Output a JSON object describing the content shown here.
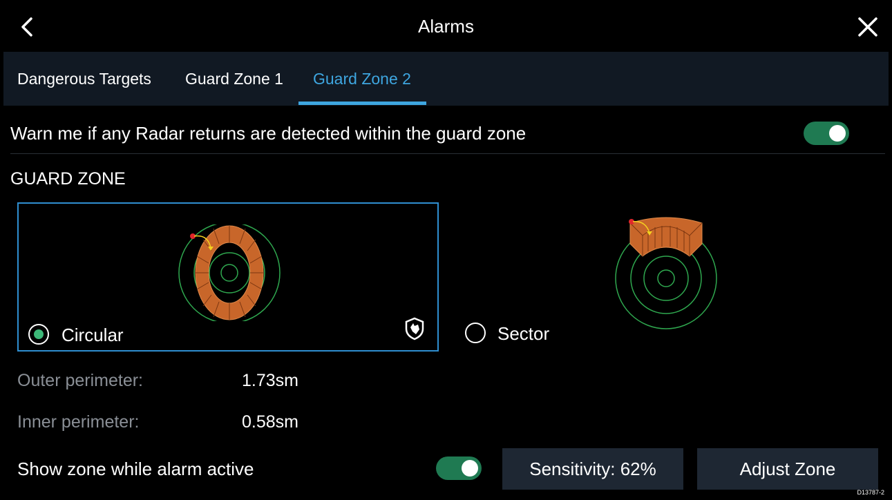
{
  "header": {
    "title": "Alarms"
  },
  "tabs": [
    {
      "label": "Dangerous Targets",
      "active": false
    },
    {
      "label": "Guard Zone 1",
      "active": false
    },
    {
      "label": "Guard Zone 2",
      "active": true
    }
  ],
  "warn": {
    "text": "Warn me if any Radar returns are detected within the guard zone",
    "enabled": true
  },
  "guard_zone": {
    "section_title": "GUARD ZONE",
    "options": [
      {
        "label": "Circular",
        "selected": true
      },
      {
        "label": "Sector",
        "selected": false
      }
    ]
  },
  "params": {
    "outer_label": "Outer perimeter:",
    "outer_value": "1.73sm",
    "inner_label": "Inner perimeter:",
    "inner_value": "0.58sm"
  },
  "bottom": {
    "show_zone_label": "Show zone while alarm active",
    "show_zone_enabled": true,
    "sensitivity_label": "Sensitivity: 62%",
    "adjust_label": "Adjust Zone"
  },
  "colors": {
    "accent": "#3ea6e0",
    "toggle_on": "#1f7a52",
    "radio_on": "#3cb878",
    "zone_fill": "#c8662a",
    "ring": "#2fa84f"
  },
  "doc_code": "D13787-2"
}
